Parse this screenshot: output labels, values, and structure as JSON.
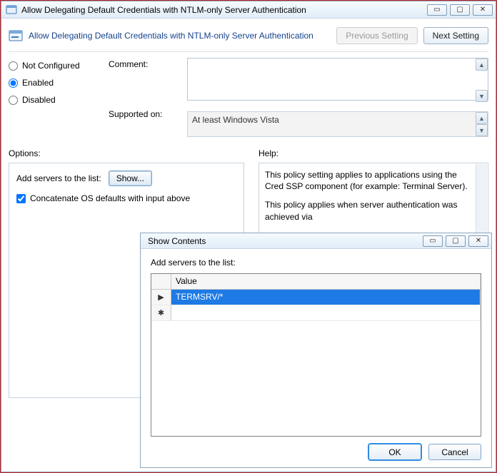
{
  "main": {
    "title": "Allow Delegating Default Credentials with NTLM-only Server Authentication",
    "header_title": "Allow Delegating Default Credentials with NTLM-only Server Authentication",
    "prev_label": "Previous Setting",
    "next_label": "Next Setting",
    "radios": {
      "not_configured": "Not Configured",
      "enabled": "Enabled",
      "disabled": "Disabled",
      "selected": "enabled"
    },
    "comment_label": "Comment:",
    "comment_value": "",
    "supported_label": "Supported on:",
    "supported_value": "At least Windows Vista",
    "options_label": "Options:",
    "help_label": "Help:",
    "options": {
      "add_servers_label": "Add servers to the list:",
      "show_label": "Show...",
      "concat_label": "Concatenate OS defaults with input above",
      "concat_checked": true
    },
    "help_text_1": "This policy setting applies to applications using the Cred SSP component (for example: Terminal Server).",
    "help_text_2": "This policy applies when server authentication was achieved via"
  },
  "dialog": {
    "title": "Show Contents",
    "prompt": "Add servers to the list:",
    "column_header": "Value",
    "row_indicator": "▶",
    "new_row_indicator": "✱",
    "rows": [
      {
        "value": "TERMSRV/*",
        "selected": true
      }
    ],
    "ok_label": "OK",
    "cancel_label": "Cancel"
  }
}
